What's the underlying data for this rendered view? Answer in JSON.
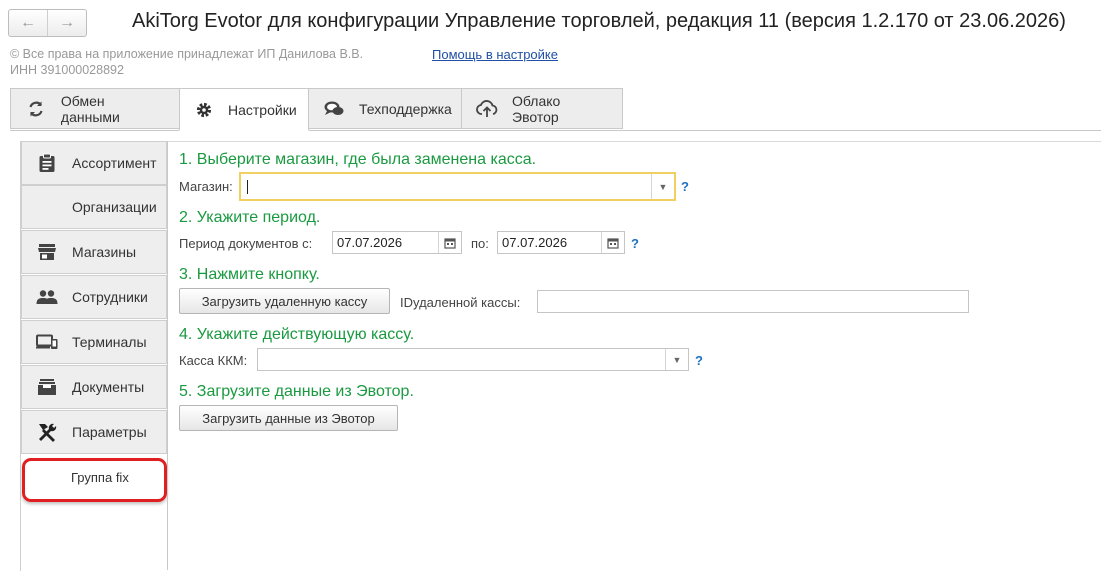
{
  "nav": {
    "back": "←",
    "forward": "→"
  },
  "window_title": "AkiTorg Evotor для конфигурации Управление торговлей, редакция 11 (версия 1.2.170 от 23.06.2026)",
  "copyright": {
    "line1": "© Все права на приложение принадлежат ИП Данилова В.В.",
    "line2": "ИНН 391000028892"
  },
  "help_link": "Помощь в настройке",
  "tabs": [
    {
      "label": "Обмен данными",
      "icon": "sync-icon"
    },
    {
      "label": "Настройки",
      "icon": "gear-icon",
      "active": true
    },
    {
      "label": "Техподдержка",
      "icon": "chat-icon"
    },
    {
      "label": "Облако Эвотор",
      "icon": "cloud-icon"
    }
  ],
  "sidebar": [
    {
      "label": "Ассортимент",
      "icon": "clipboard-icon"
    },
    {
      "label": "Организации",
      "icon": ""
    },
    {
      "label": "Магазины",
      "icon": "store-icon"
    },
    {
      "label": "Сотрудники",
      "icon": "people-icon"
    },
    {
      "label": "Терминалы",
      "icon": "devices-icon"
    },
    {
      "label": "Документы",
      "icon": "inbox-icon"
    },
    {
      "label": "Параметры",
      "icon": "tools-icon"
    },
    {
      "label": "Группа fix",
      "icon": ""
    }
  ],
  "steps": {
    "s1": "1. Выберите магазин, где была заменена касса.",
    "s2": "2. Укажите период.",
    "s3": "3. Нажмите кнопку.",
    "s4": "4. Укажите действующую кассу.",
    "s5": "5. Загрузите данные из Эвотор."
  },
  "form": {
    "store_label": "Магазин:",
    "store_value": "",
    "period_label": "Период  документов с:",
    "date_from": "07.07.2026",
    "to_label": "по:",
    "date_to": "07.07.2026",
    "load_remote_button": "Загрузить удаленную кассу",
    "remote_id_label": "IDудаленной кассы:",
    "remote_id_value": "",
    "kkm_label": "Касса ККМ:",
    "kkm_value": "",
    "load_evotor_button": "Загрузить данные из Эвотор",
    "help_mark": "?"
  }
}
